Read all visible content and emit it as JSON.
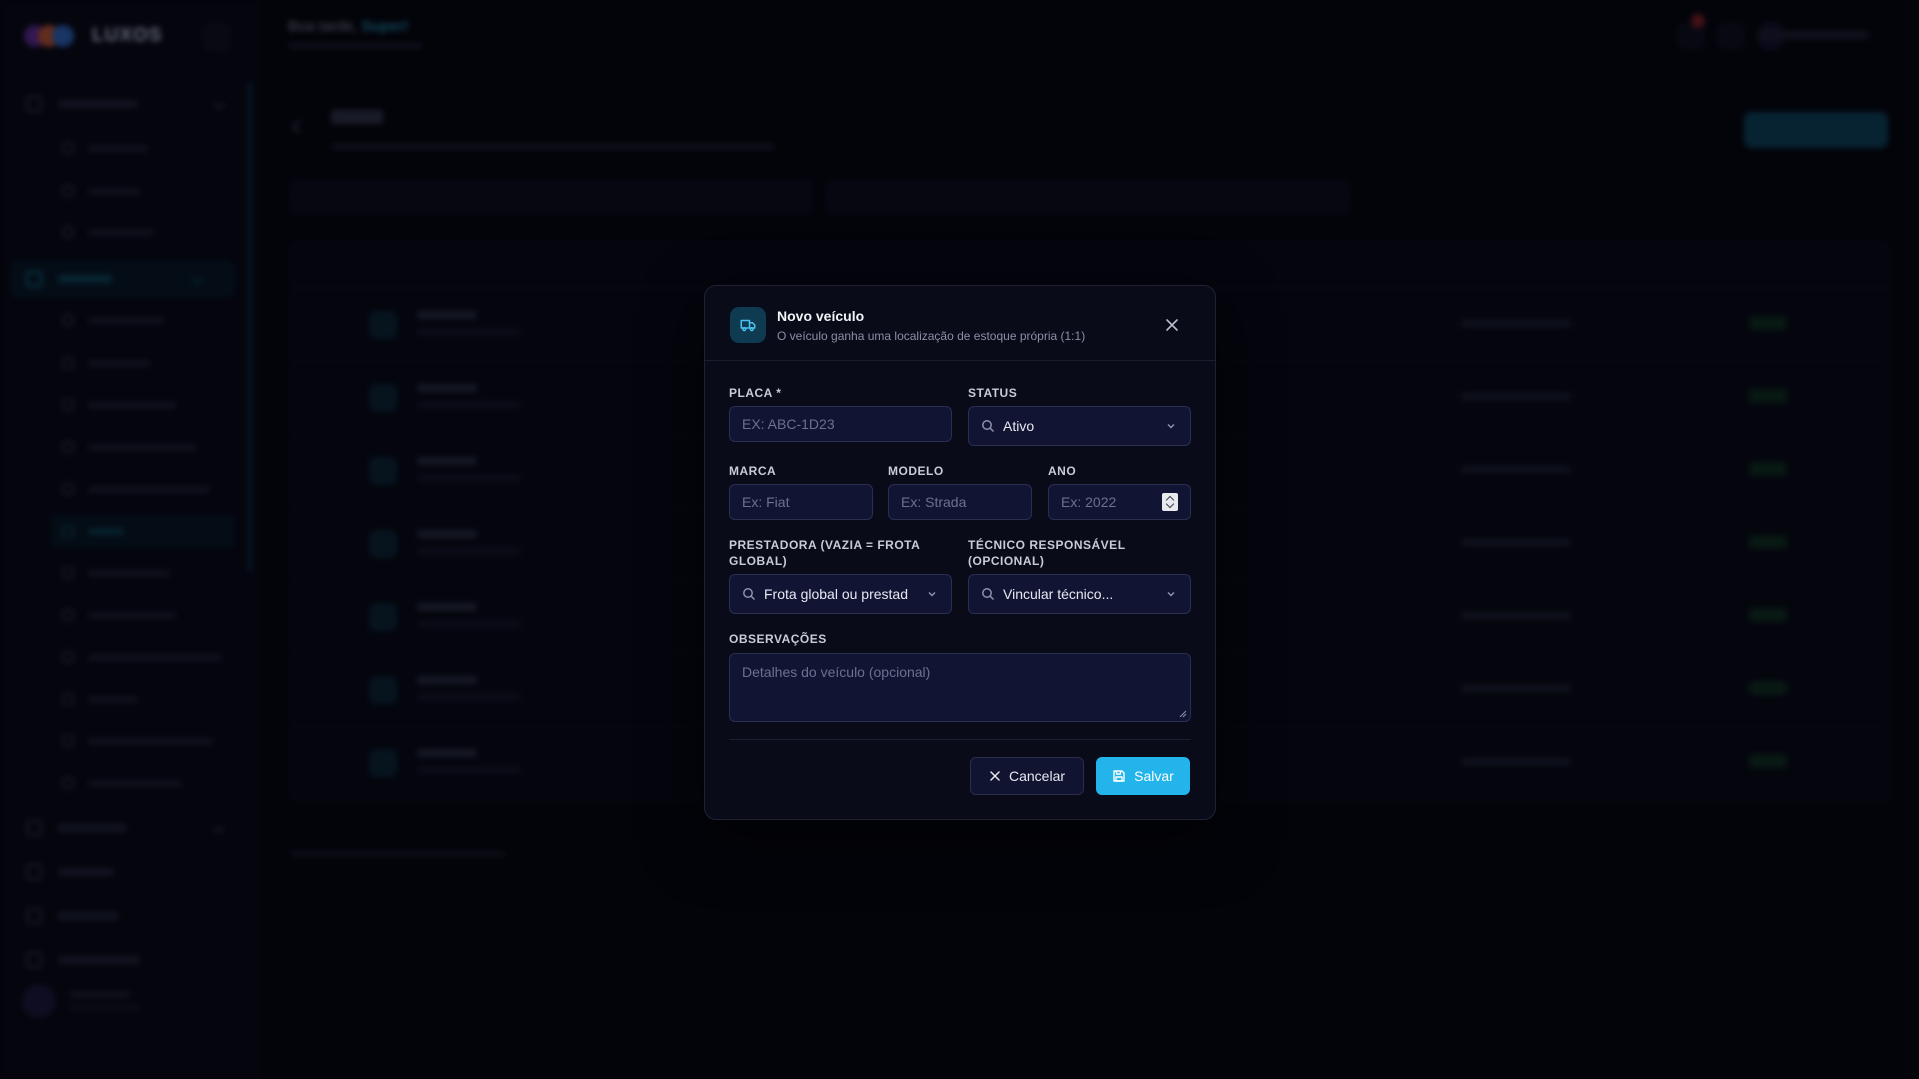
{
  "colors": {
    "accent": "#22b4ea",
    "modal_bg": "#090b18",
    "field_bg": "#111533",
    "page_bg": "#05060c"
  },
  "background": {
    "logo": "LUXOS",
    "greeting_prefix": "Boa tarde,",
    "greeting_name": "Super!"
  },
  "modal": {
    "title": "Novo veículo",
    "subtitle": "O veículo ganha uma localização de estoque própria (1:1)",
    "fields": {
      "placa": {
        "label": "PLACA *",
        "placeholder": "EX: ABC-1D23",
        "value": ""
      },
      "status": {
        "label": "STATUS",
        "value": "Ativo"
      },
      "marca": {
        "label": "MARCA",
        "placeholder": "Ex: Fiat",
        "value": ""
      },
      "modelo": {
        "label": "MODELO",
        "placeholder": "Ex: Strada",
        "value": ""
      },
      "ano": {
        "label": "ANO",
        "placeholder": "Ex: 2022",
        "value": ""
      },
      "prestadora": {
        "label_line1": "PRESTADORA (VAZIA = FROTA",
        "label_line2": "GLOBAL)",
        "value": "Frota global ou prestad"
      },
      "tecnico": {
        "label_line1": "TÉCNICO RESPONSÁVEL",
        "label_line2": "(OPCIONAL)",
        "value": "Vincular técnico..."
      },
      "observacoes": {
        "label": "OBSERVAÇÕES",
        "placeholder": "Detalhes do veículo (opcional)",
        "value": ""
      }
    },
    "buttons": {
      "cancel": "Cancelar",
      "save": "Salvar"
    },
    "icons": {
      "header": "truck-icon",
      "close": "close-icon",
      "search": "search-icon",
      "chevron": "chevron-down-icon",
      "save": "save-icon",
      "cancel": "x-icon"
    }
  }
}
